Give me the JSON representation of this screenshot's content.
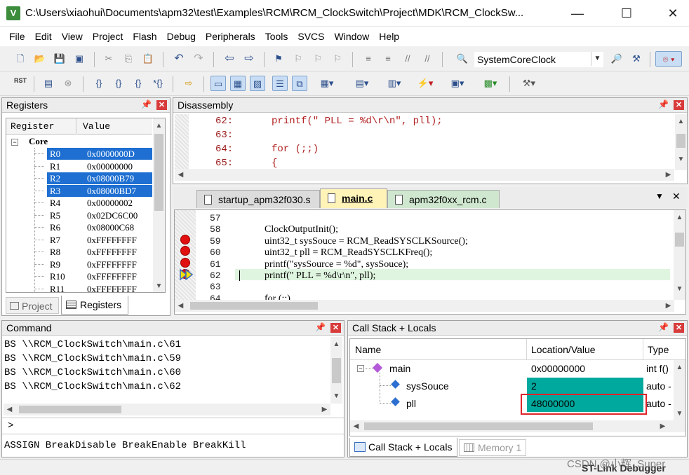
{
  "window": {
    "title": "C:\\Users\\xiaohui\\Documents\\apm32\\test\\Examples\\RCM\\RCM_ClockSwitch\\Project\\MDK\\RCM_ClockSw...",
    "app_icon": "V",
    "minimize": "—",
    "maximize": "☐",
    "close": "✕"
  },
  "menu": [
    "File",
    "Edit",
    "View",
    "Project",
    "Flash",
    "Debug",
    "Peripherals",
    "Tools",
    "SVCS",
    "Window",
    "Help"
  ],
  "toolbar": {
    "function_combo": "SystemCoreClock",
    "rst_label": "RST"
  },
  "registers": {
    "title": "Registers",
    "col_register": "Register",
    "col_value": "Value",
    "group": "Core",
    "rows": [
      {
        "name": "R0",
        "value": "0x0000000D",
        "selected": true
      },
      {
        "name": "R1",
        "value": "0x00000000",
        "selected": false
      },
      {
        "name": "R2",
        "value": "0x08000B79",
        "selected": true
      },
      {
        "name": "R3",
        "value": "0x08000BD7",
        "selected": true
      },
      {
        "name": "R4",
        "value": "0x00000002",
        "selected": false
      },
      {
        "name": "R5",
        "value": "0x02DC6C00",
        "selected": false
      },
      {
        "name": "R6",
        "value": "0x08000C68",
        "selected": false
      },
      {
        "name": "R7",
        "value": "0xFFFFFFFF",
        "selected": false
      },
      {
        "name": "R8",
        "value": "0xFFFFFFFF",
        "selected": false
      },
      {
        "name": "R9",
        "value": "0xFFFFFFFF",
        "selected": false
      },
      {
        "name": "R10",
        "value": "0xFFFFFFFF",
        "selected": false
      },
      {
        "name": "R11",
        "value": "0xFFFFFFFF",
        "selected": false
      }
    ],
    "tab_project": "Project",
    "tab_registers": "Registers"
  },
  "disassembly": {
    "title": "Disassembly",
    "lines": [
      {
        "num": "62:",
        "code": "printf(\" PLL = %d\\r\\n\", pll);"
      },
      {
        "num": "63:",
        "code": ""
      },
      {
        "num": "64:",
        "code": "for (;;)"
      },
      {
        "num": "65:",
        "code": "{"
      }
    ]
  },
  "editor": {
    "tabs": [
      "startup_apm32f030.s",
      "main.c",
      "apm32f0xx_rcm.c"
    ],
    "active_tab": "main.c",
    "lines": [
      {
        "num": "57",
        "code": ""
      },
      {
        "num": "58",
        "code": "ClockOutputInit();"
      },
      {
        "num": "59",
        "code": "uint32_t sysSouce = RCM_ReadSYSCLKSource();"
      },
      {
        "num": "60",
        "code": "uint32_t pll = RCM_ReadSYSCLKFreq();"
      },
      {
        "num": "61",
        "code": "printf(\"sysSource = %d\", sysSouce);"
      },
      {
        "num": "62",
        "code": "printf(\" PLL = %d\\r\\n\", pll);"
      },
      {
        "num": "63",
        "code": ""
      },
      {
        "num": "64",
        "code": "for (;;)"
      }
    ]
  },
  "command": {
    "title": "Command",
    "lines": [
      "BS \\\\RCM_ClockSwitch\\main.c\\61",
      "BS \\\\RCM_ClockSwitch\\main.c\\59",
      "BS \\\\RCM_ClockSwitch\\main.c\\60",
      "BS \\\\RCM_ClockSwitch\\main.c\\62"
    ],
    "prompt": ">",
    "hint": "ASSIGN BreakDisable BreakEnable BreakKill"
  },
  "callstack": {
    "title": "Call Stack + Locals",
    "col_name": "Name",
    "col_value": "Location/Value",
    "col_type": "Type",
    "rows": [
      {
        "name": "main",
        "value": "0x00000000",
        "type": "int f()"
      },
      {
        "name": "sysSouce",
        "value": "2",
        "type": "auto -"
      },
      {
        "name": "pll",
        "value": "48000000",
        "type": "auto -"
      }
    ],
    "tab_callstack": "Call Stack + Locals",
    "tab_memory": "Memory 1"
  },
  "statusbar": {
    "debugger": "ST-Link Debugger",
    "watermark": "CSDN @小辉_Super"
  },
  "colors": {
    "selection": "#1e6fd1",
    "value_highlight": "#00a99d",
    "current_line": "#dff5df",
    "breakpoint": "#e11010",
    "red_box": "#e0242b"
  }
}
